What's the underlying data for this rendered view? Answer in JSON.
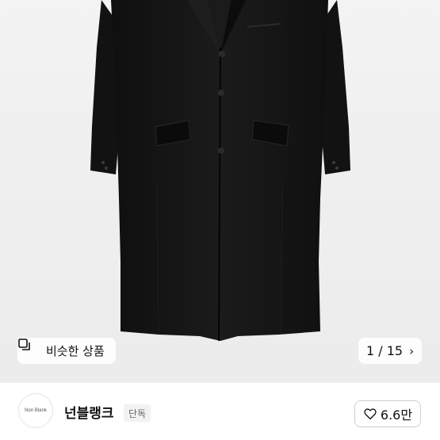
{
  "product_image": {
    "subject": "black-coat-image",
    "similar_button": {
      "label": "비슷한 상품",
      "icon": "similar-products-icon"
    },
    "pager": {
      "current": "1",
      "separator": "/",
      "total": "15",
      "icon": "chevron-right-icon"
    }
  },
  "store": {
    "logo_text": "Non Blank",
    "name": "넌블랭크",
    "badge": "단독",
    "likes": {
      "count": "6.6만",
      "icon": "heart-icon"
    }
  },
  "colors": {
    "coat": "#141414",
    "background": "#efefef",
    "text": "#111111"
  }
}
